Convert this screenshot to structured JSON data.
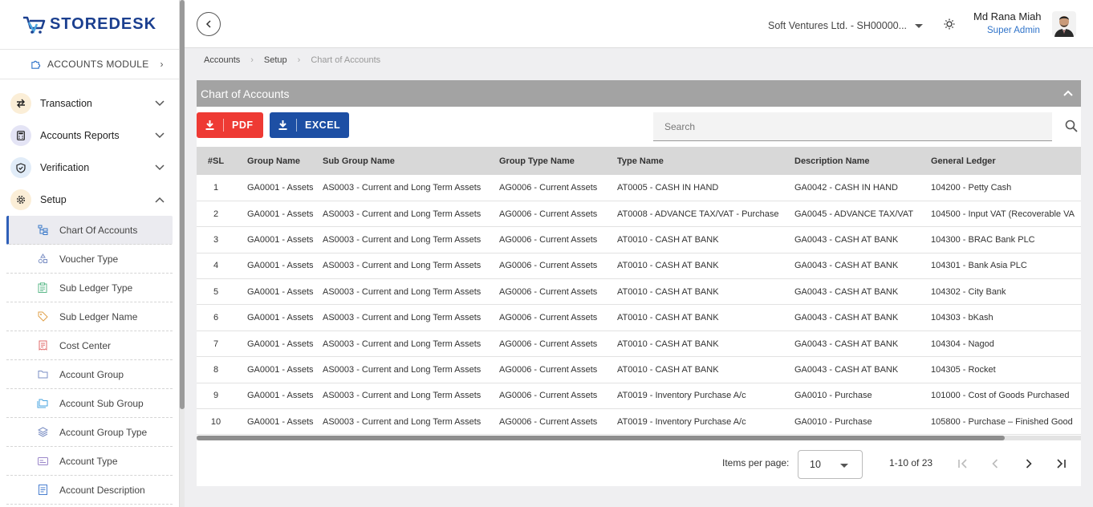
{
  "brand": {
    "logo_text": "STOREDESK"
  },
  "sidebar": {
    "module_label": "ACCOUNTS MODULE",
    "menu": [
      {
        "label": "Transaction",
        "icon": "transfer-icon",
        "expanded": false
      },
      {
        "label": "Accounts Reports",
        "icon": "calculator-icon",
        "expanded": false
      },
      {
        "label": "Verification",
        "icon": "shield-check-icon",
        "expanded": false
      },
      {
        "label": "Setup",
        "icon": "gear-icon",
        "expanded": true
      }
    ],
    "setup_items": [
      {
        "label": "Chart Of Accounts",
        "icon": "hierarchy-icon",
        "active": true
      },
      {
        "label": "Voucher Type",
        "icon": "shapes-icon",
        "active": false
      },
      {
        "label": "Sub Ledger Type",
        "icon": "clipboard-icon",
        "active": false
      },
      {
        "label": "Sub Ledger Name",
        "icon": "tag-icon",
        "active": false
      },
      {
        "label": "Cost Center",
        "icon": "receipt-icon",
        "active": false
      },
      {
        "label": "Account Group",
        "icon": "folder-icon",
        "active": false
      },
      {
        "label": "Account Sub Group",
        "icon": "folders-icon",
        "active": false
      },
      {
        "label": "Account Group Type",
        "icon": "layers-icon",
        "active": false
      },
      {
        "label": "Account Type",
        "icon": "card-icon",
        "active": false
      },
      {
        "label": "Account Description",
        "icon": "document-icon",
        "active": false
      }
    ]
  },
  "topbar": {
    "company": "Soft Ventures Ltd. - SH00000...",
    "user_name": "Md Rana Miah",
    "user_role": "Super Admin"
  },
  "breadcrumb": [
    "Accounts",
    "Setup",
    "Chart of Accounts"
  ],
  "panel": {
    "title": "Chart of Accounts",
    "pdf_label": "PDF",
    "excel_label": "EXCEL",
    "search_placeholder": "Search"
  },
  "table": {
    "columns": [
      "#SL",
      "Group Name",
      "Sub Group Name",
      "Group Type Name",
      "Type Name",
      "Description Name",
      "General Ledger"
    ],
    "rows": [
      [
        "1",
        "GA0001 - Assets",
        "AS0003 - Current and Long Term Assets",
        "AG0006 - Current Assets",
        "AT0005 - CASH IN HAND",
        "GA0042 - CASH IN HAND",
        "104200 - Petty Cash"
      ],
      [
        "2",
        "GA0001 - Assets",
        "AS0003 - Current and Long Term Assets",
        "AG0006 - Current Assets",
        "AT0008 - ADVANCE TAX/VAT - Purchase",
        "GA0045 - ADVANCE TAX/VAT",
        "104500 - Input VAT (Recoverable VA"
      ],
      [
        "3",
        "GA0001 - Assets",
        "AS0003 - Current and Long Term Assets",
        "AG0006 - Current Assets",
        "AT0010 - CASH AT BANK",
        "GA0043 - CASH AT BANK",
        "104300 - BRAC Bank PLC"
      ],
      [
        "4",
        "GA0001 - Assets",
        "AS0003 - Current and Long Term Assets",
        "AG0006 - Current Assets",
        "AT0010 - CASH AT BANK",
        "GA0043 - CASH AT BANK",
        "104301 - Bank Asia PLC"
      ],
      [
        "5",
        "GA0001 - Assets",
        "AS0003 - Current and Long Term Assets",
        "AG0006 - Current Assets",
        "AT0010 - CASH AT BANK",
        "GA0043 - CASH AT BANK",
        "104302 - City Bank"
      ],
      [
        "6",
        "GA0001 - Assets",
        "AS0003 - Current and Long Term Assets",
        "AG0006 - Current Assets",
        "AT0010 - CASH AT BANK",
        "GA0043 - CASH AT BANK",
        "104303 - bKash"
      ],
      [
        "7",
        "GA0001 - Assets",
        "AS0003 - Current and Long Term Assets",
        "AG0006 - Current Assets",
        "AT0010 - CASH AT BANK",
        "GA0043 - CASH AT BANK",
        "104304 - Nagod"
      ],
      [
        "8",
        "GA0001 - Assets",
        "AS0003 - Current and Long Term Assets",
        "AG0006 - Current Assets",
        "AT0010 - CASH AT BANK",
        "GA0043 - CASH AT BANK",
        "104305 - Rocket"
      ],
      [
        "9",
        "GA0001 - Assets",
        "AS0003 - Current and Long Term Assets",
        "AG0006 - Current Assets",
        "AT0019 - Inventory Purchase A/c",
        "GA0010 - Purchase",
        "101000 - Cost of Goods Purchased"
      ],
      [
        "10",
        "GA0001 - Assets",
        "AS0003 - Current and Long Term Assets",
        "AG0006 - Current Assets",
        "AT0019 - Inventory Purchase A/c",
        "GA0010 - Purchase",
        "105800 - Purchase – Finished Good"
      ]
    ]
  },
  "paginator": {
    "items_per_page_label": "Items per page:",
    "page_size": "10",
    "range_label": "1-10 of 23"
  },
  "colors": {
    "pdf": "#ee3a34",
    "excel": "#1d4fa4",
    "panel_header": "#a3a3a3",
    "accent_link": "#2f73c9"
  }
}
